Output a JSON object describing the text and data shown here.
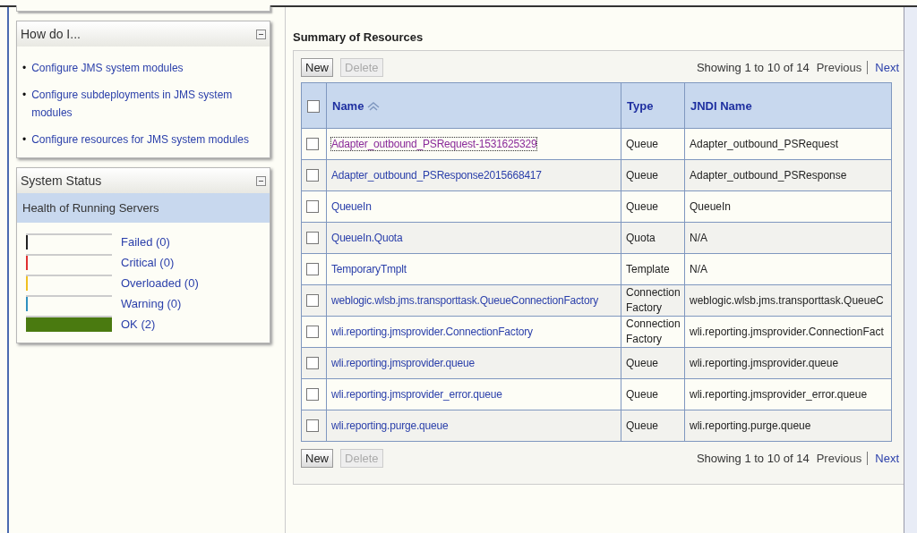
{
  "how_do_i": {
    "title": "How do I...",
    "links": [
      {
        "bullet": "•",
        "label": "Configure JMS system modules"
      },
      {
        "bullet": "•",
        "label": "Configure subdeployments in JMS system modules"
      },
      {
        "bullet": "•",
        "label": "Configure resources for JMS system modules"
      }
    ]
  },
  "system_status": {
    "title": "System Status",
    "subtitle": "Health of Running Servers",
    "items": [
      {
        "label": "Failed (0)",
        "level": 0,
        "color": "#222222"
      },
      {
        "label": "Critical (0)",
        "level": 0,
        "color": "#e03030"
      },
      {
        "label": "Overloaded (0)",
        "level": 0,
        "color": "#f0c020"
      },
      {
        "label": "Warning (0)",
        "level": 0,
        "color": "#3090c0"
      },
      {
        "label": "OK (2)",
        "level": 1,
        "color": "#4a7a10"
      }
    ]
  },
  "summary": {
    "title": "Summary of Resources",
    "top_toolbar": {
      "buttons": [
        {
          "label": "New",
          "disabled": false
        },
        {
          "label": "Delete",
          "disabled": true
        }
      ],
      "showing": "Showing 1 to 10 of 14",
      "previous": "Previous",
      "next": "Next"
    },
    "select_all_checked": false,
    "columns": [
      "Name",
      "Type",
      "JNDI Name"
    ],
    "rows": [
      {
        "name": "Adapter_outbound_PSRequest-1531625329",
        "type": "Queue",
        "jndi": "Adapter_outbound_PSRequest",
        "checked": false,
        "visited": true
      },
      {
        "name": "Adapter_outbound_PSResponse2015668417",
        "type": "Queue",
        "jndi": "Adapter_outbound_PSResponse",
        "checked": false,
        "visited": false
      },
      {
        "name": "QueueIn",
        "type": "Queue",
        "jndi": "QueueIn",
        "checked": false,
        "visited": false
      },
      {
        "name": "QueueIn.Quota",
        "type": "Quota",
        "jndi": "N/A",
        "checked": false,
        "visited": false
      },
      {
        "name": "TemporaryTmplt",
        "type": "Template",
        "jndi": "N/A",
        "checked": false,
        "visited": false
      },
      {
        "name": "weblogic.wlsb.jms.transporttask.QueueConnectionFactory",
        "type": "Connection Factory",
        "jndi": "weblogic.wlsb.jms.transporttask.QueueC",
        "checked": false,
        "visited": false
      },
      {
        "name": "wli.reporting.jmsprovider.ConnectionFactory",
        "type": "Connection Factory",
        "jndi": "wli.reporting.jmsprovider.ConnectionFact",
        "checked": false,
        "visited": false
      },
      {
        "name": "wli.reporting.jmsprovider.queue",
        "type": "Queue",
        "jndi": "wli.reporting.jmsprovider.queue",
        "checked": false,
        "visited": false
      },
      {
        "name": "wli.reporting.jmsprovider_error.queue",
        "type": "Queue",
        "jndi": "wli.reporting.jmsprovider_error.queue",
        "checked": false,
        "visited": false
      },
      {
        "name": "wli.reporting.purge.queue",
        "type": "Queue",
        "jndi": "wli.reporting.purge.queue",
        "checked": false,
        "visited": false
      }
    ],
    "bottom_toolbar": {
      "buttons": [
        {
          "label": "New",
          "disabled": false
        },
        {
          "label": "Delete",
          "disabled": true
        }
      ],
      "showing": "Showing 1 to 10 of 14",
      "previous": "Previous",
      "next": "Next"
    }
  }
}
